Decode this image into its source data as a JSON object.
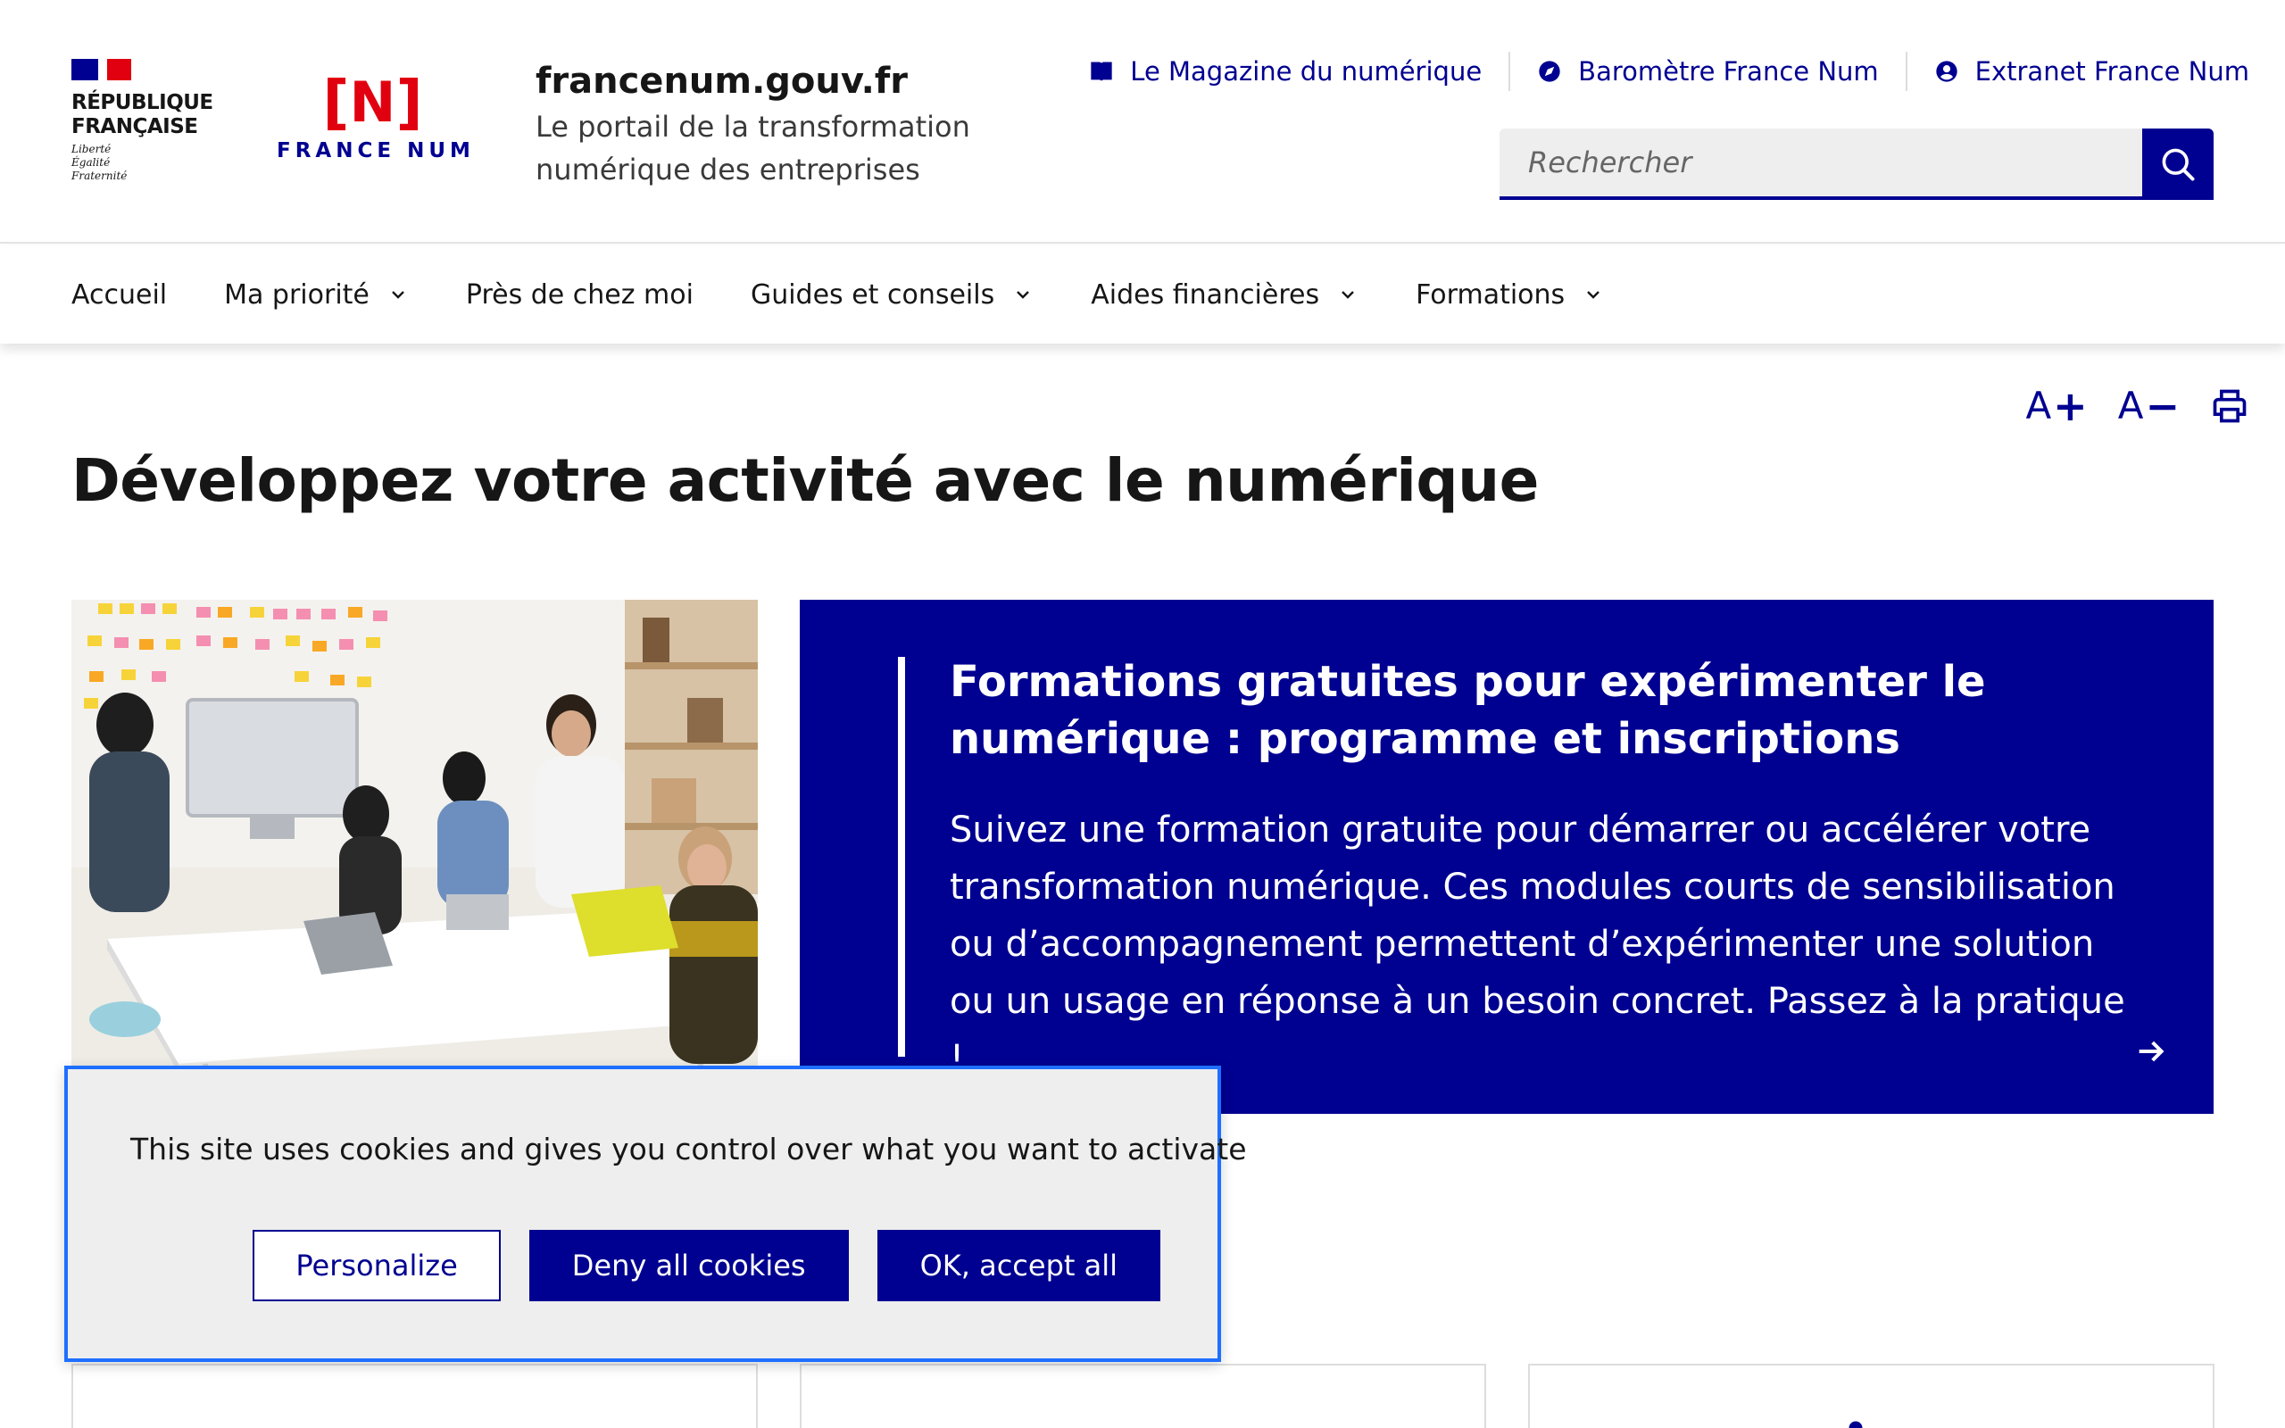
{
  "brand": {
    "republique": "RÉPUBLIQUE\nFRANÇAISE",
    "motto": "Liberté\nÉgalité\nFraternité",
    "logo_letter": "N",
    "logo_label": "FRANCE NUM",
    "site_title": "francenum.gouv.fr",
    "site_tagline": "Le portail de la transformation numérique des entreprises"
  },
  "header_links": [
    {
      "label": "Le Magazine du numérique",
      "icon": "book-icon"
    },
    {
      "label": "Baromètre France Num",
      "icon": "compass-icon"
    },
    {
      "label": "Extranet France Num",
      "icon": "user-icon"
    }
  ],
  "search": {
    "placeholder": "Rechercher",
    "value": ""
  },
  "nav": [
    {
      "label": "Accueil",
      "dropdown": false
    },
    {
      "label": "Ma priorité",
      "dropdown": true
    },
    {
      "label": "Près de chez moi",
      "dropdown": false
    },
    {
      "label": "Guides et conseils",
      "dropdown": true
    },
    {
      "label": "Aides financières",
      "dropdown": true
    },
    {
      "label": "Formations",
      "dropdown": true
    }
  ],
  "page_tools": {
    "increase": "A",
    "decrease": "A"
  },
  "page_title": "Développez votre activité avec le numérique",
  "feature": {
    "title": "Formations gratuites pour expérimenter le numérique : programme et inscriptions",
    "description": "Suivez une formation gratuite pour démarrer ou accélérer votre transformation numérique. Ces modules courts de sensibilisation ou d’accompagnement permettent d’expérimenter une solution ou un usage en réponse à un besoin concret. Passez à la pratique !"
  },
  "cookie_banner": {
    "message": "This site uses cookies and gives you control over what you want to activate",
    "personalize": "Personalize",
    "deny": "Deny all cookies",
    "accept": "OK, accept all"
  },
  "colors": {
    "primary": "#000091",
    "accent_red": "#e1000f",
    "banner_bg": "#eeeeee",
    "focus_outline": "#1e6fff"
  }
}
